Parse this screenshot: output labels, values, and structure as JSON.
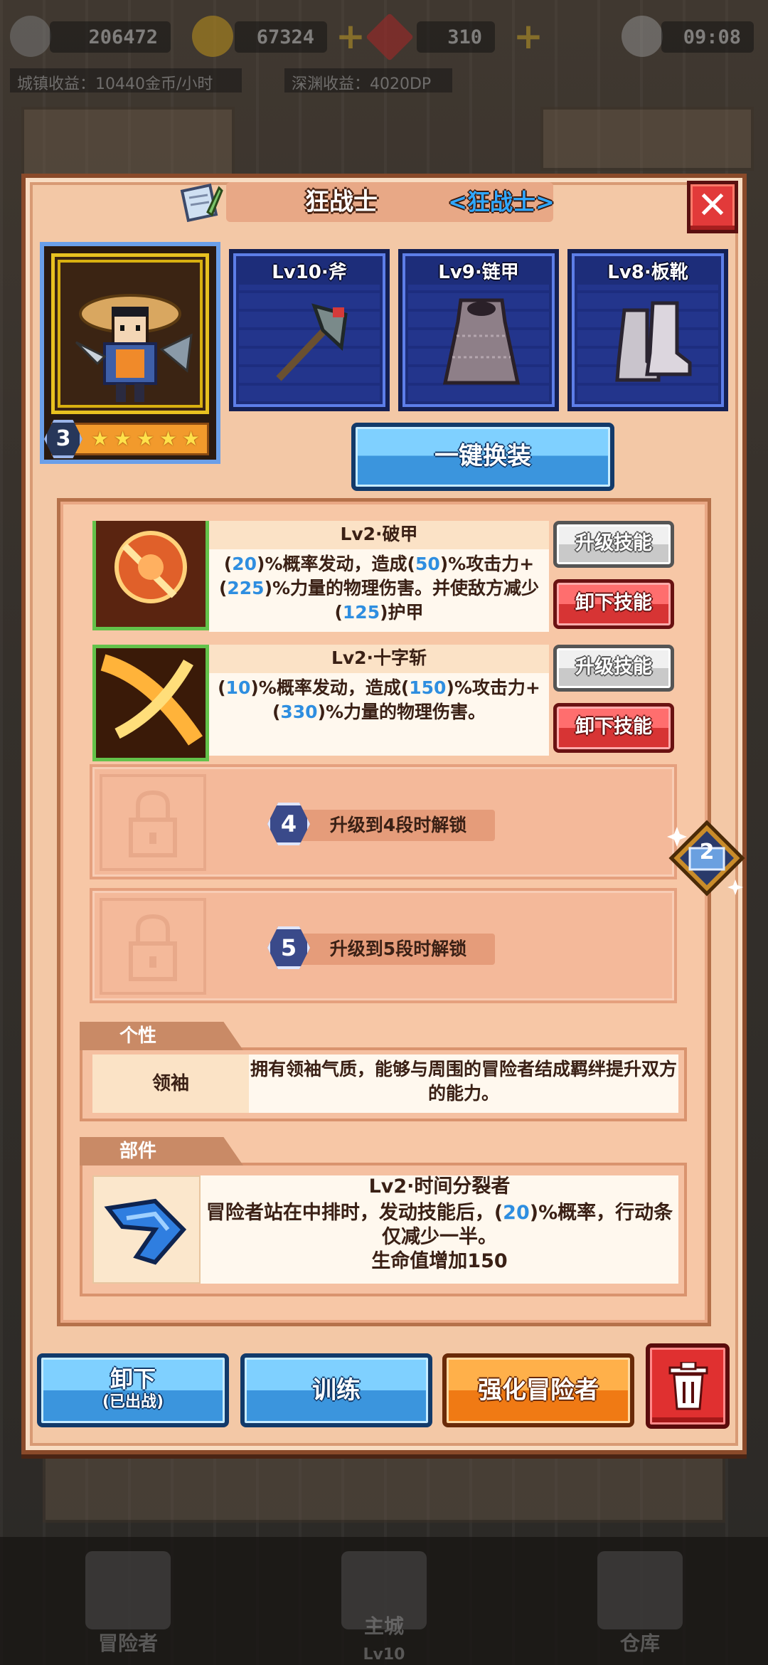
{
  "topbar": {
    "gold_score": "206472",
    "coins": "67324",
    "gems": "310",
    "time": "09:08",
    "town_income": "城镇收益：10440金币/小时",
    "abyss_income": "深渊收益：4020DP"
  },
  "hero": {
    "name": "狂战士",
    "class_tag": "<狂战士>",
    "stage": "3",
    "stars": [
      "★",
      "★",
      "★",
      "★",
      "★"
    ]
  },
  "equipment": [
    {
      "label": "Lv10·斧",
      "icon": "axe-icon"
    },
    {
      "label": "Lv9·链甲",
      "icon": "chainmail-icon"
    },
    {
      "label": "Lv8·板靴",
      "icon": "plate-boots-icon"
    }
  ],
  "equip_all_label": "一键换装",
  "skills": [
    {
      "title": "Lv2·破甲",
      "desc": [
        {
          "t": "(",
          "hl": false
        },
        {
          "t": "20",
          "hl": true
        },
        {
          "t": ")%概率发动，造成(",
          "hl": false
        },
        {
          "t": "50",
          "hl": true
        },
        {
          "t": ")%攻击力+(",
          "hl": false
        },
        {
          "t": "225",
          "hl": true
        },
        {
          "t": ")%力量的物理伤害。并使敌方减少(",
          "hl": false
        },
        {
          "t": "125",
          "hl": true
        },
        {
          "t": ")护甲",
          "hl": false
        }
      ],
      "upgrade_label": "升级技能",
      "unequip_label": "卸下技能"
    },
    {
      "title": "Lv2·十字斩",
      "desc": [
        {
          "t": "(",
          "hl": false
        },
        {
          "t": "10",
          "hl": true
        },
        {
          "t": ")%概率发动，造成(",
          "hl": false
        },
        {
          "t": "150",
          "hl": true
        },
        {
          "t": ")%攻击力+(",
          "hl": false
        },
        {
          "t": "330",
          "hl": true
        },
        {
          "t": ")%力量的物理伤害。",
          "hl": false
        }
      ],
      "upgrade_label": "升级技能",
      "unequip_label": "卸下技能"
    }
  ],
  "locked_slots": [
    {
      "stage": "4",
      "text": "升级到4段时解锁"
    },
    {
      "stage": "5",
      "text": "升级到5段时解锁"
    }
  ],
  "side_badge": "2",
  "trait": {
    "section": "个性",
    "name": "领袖",
    "desc": "拥有领袖气质，能够与周围的冒险者结成羁绊提升双方的能力。"
  },
  "part": {
    "section": "部件",
    "title": "Lv2·时间分裂者",
    "desc_parts": [
      {
        "t": "冒险者站在中排时，发动技能后，(",
        "hl": false
      },
      {
        "t": "20",
        "hl": true
      },
      {
        "t": ")%概率，行动条仅减少一半。",
        "hl": false
      }
    ],
    "bonus": "生命值增加150"
  },
  "actions": {
    "unequip": "卸下",
    "unequip_sub": "(已出战)",
    "train": "训练",
    "enhance": "强化冒险者",
    "delete_icon": "trash-icon"
  },
  "nav": {
    "adventurer": "冒险者",
    "main_city": "主城",
    "main_city_lv": "Lv10",
    "warehouse": "仓库"
  },
  "colors": {
    "panel": "#f3c8a6",
    "accent_blue": "#2e8ee0",
    "equip_bg": "#1d2d7a",
    "danger": "#e03030",
    "orange": "#f07a14"
  }
}
